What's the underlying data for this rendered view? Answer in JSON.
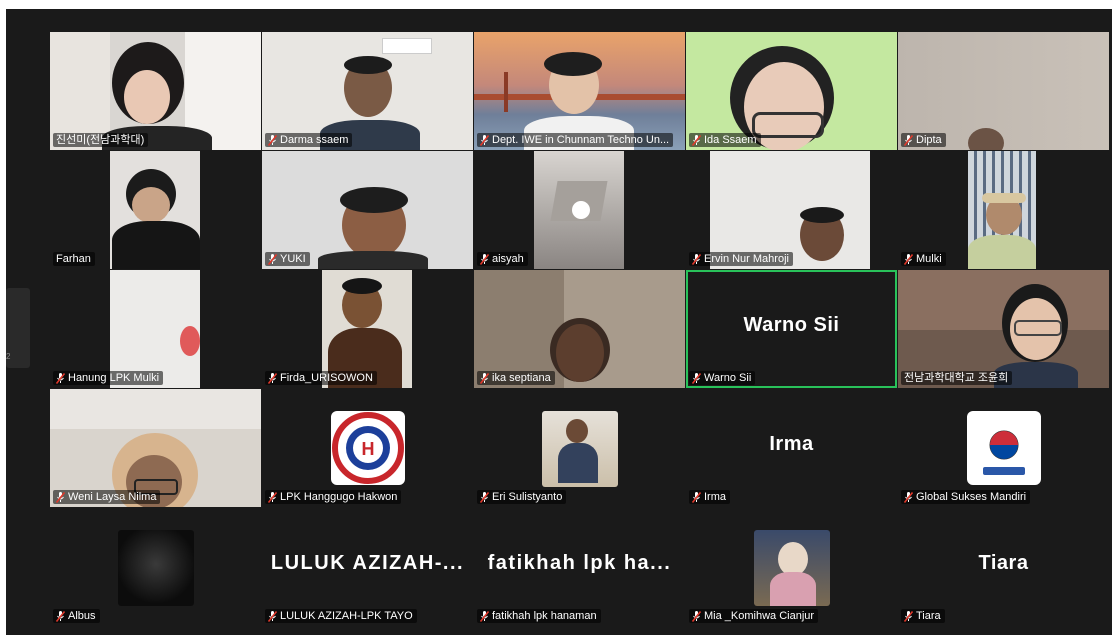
{
  "participants": [
    {
      "name": "진선미(전남과학대)",
      "muted": false
    },
    {
      "name": "Darma ssaem",
      "muted": true
    },
    {
      "name": "Dept. IWE in Chunnam Techno Un...",
      "muted": true
    },
    {
      "name": "Ida Ssaem",
      "muted": true
    },
    {
      "name": "Dipta",
      "muted": true
    },
    {
      "name": "Farhan",
      "muted": false
    },
    {
      "name": "YUKI",
      "muted": true
    },
    {
      "name": "aisyah",
      "muted": true
    },
    {
      "name": "Ervin Nur Mahroji",
      "muted": true
    },
    {
      "name": "Mulki",
      "muted": true
    },
    {
      "name": "Hanung LPK Mulki",
      "muted": true
    },
    {
      "name": "Firda_URISOWON",
      "muted": true
    },
    {
      "name": "ika septiana",
      "muted": true
    },
    {
      "name": "Warno Sii",
      "muted": true,
      "display": "Warno Sii",
      "active_speaker": true
    },
    {
      "name": "전남과학대학교 조윤희",
      "muted": false
    },
    {
      "name": "Weni Laysa Nilma",
      "muted": true
    },
    {
      "name": "LPK Hanggugo Hakwon",
      "muted": true
    },
    {
      "name": "Eri Sulistyanto",
      "muted": true
    },
    {
      "name": "Irma",
      "muted": true,
      "display": "Irma"
    },
    {
      "name": "Global Sukses Mandiri",
      "muted": true
    },
    {
      "name": "Albus",
      "muted": true
    },
    {
      "name": "LULUK AZIZAH-LPK TAYO",
      "muted": true,
      "display": "LULUK AZIZAH-..."
    },
    {
      "name": "fatikhah lpk hanaman",
      "muted": true,
      "display": "fatikhah lpk ha..."
    },
    {
      "name": "Mia _Komihwa Cianjur",
      "muted": true
    },
    {
      "name": "Tiara",
      "muted": true,
      "display": "Tiara"
    }
  ],
  "sidebar_page_number": "2",
  "colors": {
    "background": "#1a1a1a",
    "active_speaker_border": "#29c25a",
    "muted_icon": "#e0382b"
  }
}
